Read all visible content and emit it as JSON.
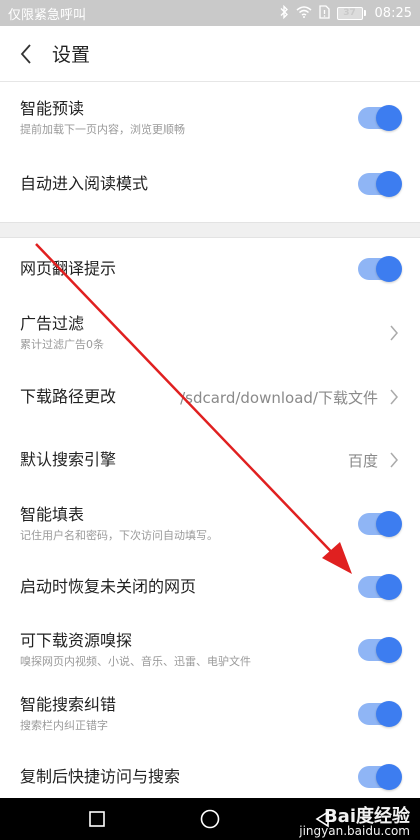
{
  "status_bar": {
    "left_text": "仅限紧急呼叫",
    "battery": "37",
    "time": "08:25"
  },
  "header": {
    "title": "设置"
  },
  "settings": {
    "smart_preread": {
      "title": "智能预读",
      "sub": "提前加载下一页内容，浏览更顺畅",
      "on": true
    },
    "auto_reader": {
      "title": "自动进入阅读模式",
      "on": true
    },
    "translate_hint": {
      "title": "网页翻译提示",
      "on": true
    },
    "ad_filter": {
      "title": "广告过滤",
      "sub": "累计过滤广告0条"
    },
    "download_path": {
      "title": "下载路径更改",
      "value": "/sdcard/download/下载文件"
    },
    "search_engine": {
      "title": "默认搜索引擎",
      "value": "百度"
    },
    "auto_fill": {
      "title": "智能填表",
      "sub": "记住用户名和密码，下次访问自动填写。",
      "on": true
    },
    "restore_pages": {
      "title": "启动时恢复未关闭的网页",
      "on": true
    },
    "resource_sniff": {
      "title": "可下载资源嗅探",
      "sub": "嗅探网页内视频、小说、音乐、迅雷、电驴文件",
      "on": true
    },
    "search_correct": {
      "title": "智能搜索纠错",
      "sub": "搜索栏内纠正错字",
      "on": true
    },
    "copy_search": {
      "title": "复制后快捷访问与搜索",
      "on": true
    }
  },
  "watermark": {
    "brand": "Bai度经验",
    "url": "jingyan.baidu.com"
  },
  "colors": {
    "accent": "#3d7df0",
    "accent_track": "#8fb5f5",
    "annotation_arrow": "#e02020"
  }
}
